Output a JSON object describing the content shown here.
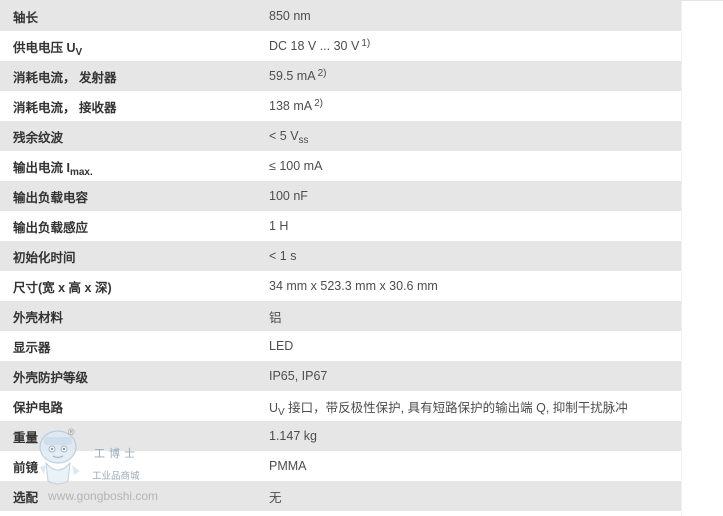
{
  "rows": [
    {
      "label": "轴长",
      "value": "850 nm"
    },
    {
      "label_main": "供电电压 U",
      "label_sub": "V",
      "value": "DC 18 V ... 30 V",
      "note": "1)"
    },
    {
      "label": "消耗电流， 发射器",
      "value": "59.5 mA",
      "note": "2)"
    },
    {
      "label": "消耗电流， 接收器",
      "value": "138 mA",
      "note": "2)"
    },
    {
      "label": "残余纹波",
      "value_main": "< 5 V",
      "value_sub": "ss"
    },
    {
      "label_main": "输出电流 I",
      "label_sub": "max.",
      "value": "≤ 100 mA"
    },
    {
      "label": "输出负载电容",
      "value": "100 nF"
    },
    {
      "label": "输出负载感应",
      "value": "1 H"
    },
    {
      "label": "初始化时间",
      "value": "< 1 s"
    },
    {
      "label": "尺寸(宽 x 高 x 深)",
      "value": "34 mm x 523.3 mm x 30.6 mm"
    },
    {
      "label": "外壳材料",
      "value": "铝"
    },
    {
      "label": "显示器",
      "value": "LED"
    },
    {
      "label": "外壳防护等级",
      "value": "IP65, IP67"
    },
    {
      "label": "保护电路",
      "value_pre": "U",
      "value_sub": "V",
      "value_post": " 接口，带反极性保护, 具有短路保护的输出端 Q, 抑制干扰脉冲"
    },
    {
      "label": "重量",
      "value": "1.147 kg"
    },
    {
      "label": "前镜",
      "value": "PMMA"
    },
    {
      "label": "选配",
      "value": "无"
    }
  ],
  "watermark": {
    "brand": "工博士",
    "registered": "®",
    "subtitle": "工业品商城",
    "url": "www.gongboshi.com"
  }
}
